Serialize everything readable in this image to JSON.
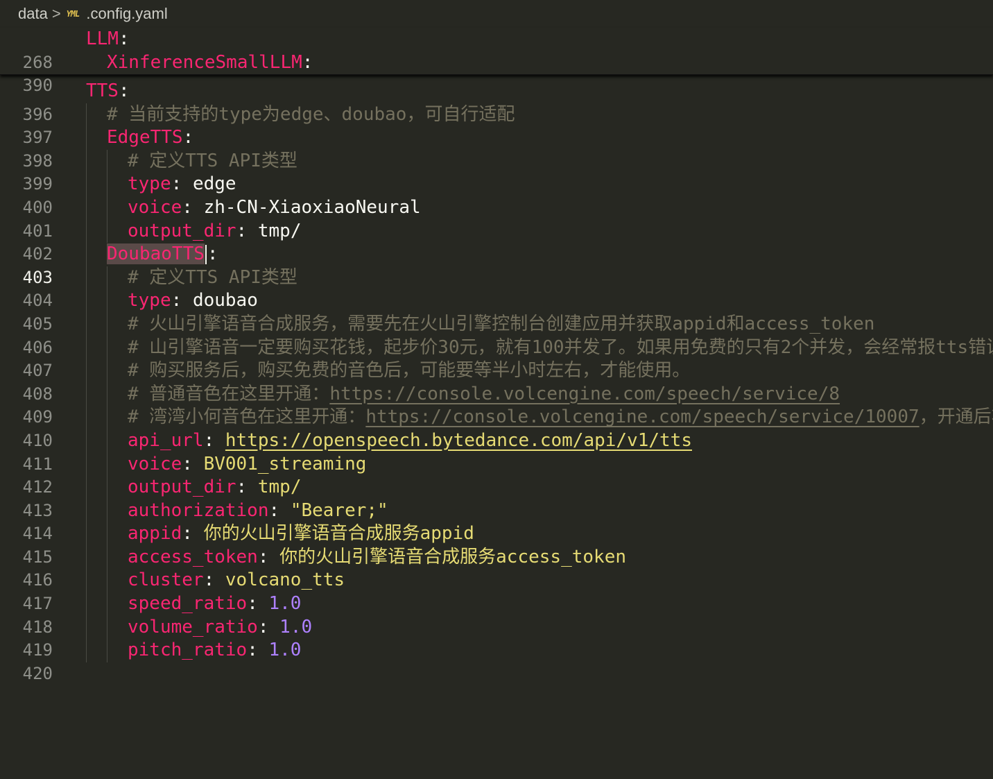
{
  "breadcrumb": {
    "folder": "data",
    "separator": ">",
    "file_icon": "YML",
    "file_name": ".config.yaml"
  },
  "sticky": [
    {
      "ln": "268",
      "key": "LLM",
      "colon": ":"
    },
    {
      "ln": "390",
      "key": "XinferenceSmallLLM",
      "colon": ":"
    }
  ],
  "lines": {
    "l396": {
      "ln": "396",
      "key": "TTS",
      "colon": ":"
    },
    "l397": {
      "ln": "397",
      "text": "# 当前支持的type为edge、doubao，可自行适配"
    },
    "l398": {
      "ln": "398",
      "key": "EdgeTTS",
      "colon": ":"
    },
    "l399": {
      "ln": "399",
      "text": "# 定义TTS API类型"
    },
    "l400": {
      "ln": "400",
      "key": "type",
      "colon": ": ",
      "value": "edge"
    },
    "l401": {
      "ln": "401",
      "key": "voice",
      "colon": ": ",
      "value": "zh-CN-XiaoxiaoNeural"
    },
    "l402": {
      "ln": "402",
      "key": "output_dir",
      "colon": ": ",
      "value": "tmp/"
    },
    "l403": {
      "ln": "403",
      "key": "DoubaoTTS",
      "colon": ":"
    },
    "l404": {
      "ln": "404",
      "text": "# 定义TTS API类型"
    },
    "l405": {
      "ln": "405",
      "key": "type",
      "colon": ": ",
      "value": "doubao"
    },
    "l406": {
      "ln": "406",
      "text": "# 火山引擎语音合成服务，需要先在火山引擎控制台创建应用并获取appid和access_token"
    },
    "l407": {
      "ln": "407",
      "text": "# 山引擎语音一定要购买花钱，起步价30元，就有100并发了。如果用免费的只有2个并发，会经常报tts错误"
    },
    "l408": {
      "ln": "408",
      "text": "# 购买服务后，购买免费的音色后，可能要等半小时左右，才能使用。"
    },
    "l409": {
      "ln": "409",
      "prefix": "# 普通音色在这里开通：",
      "link": "https://console.volcengine.com/speech/service/8"
    },
    "l410": {
      "ln": "410",
      "prefix": "# 湾湾小何音色在这里开通：",
      "link": "https://console.volcengine.com/speech/service/10007",
      "suffix": "，开通后将下"
    },
    "l411": {
      "ln": "411",
      "key": "api_url",
      "colon": ": ",
      "link": "https://openspeech.bytedance.com/api/v1/tts"
    },
    "l412": {
      "ln": "412",
      "key": "voice",
      "colon": ": ",
      "value": "BV001_streaming"
    },
    "l413": {
      "ln": "413",
      "key": "output_dir",
      "colon": ": ",
      "value": "tmp/"
    },
    "l414": {
      "ln": "414",
      "key": "authorization",
      "colon": ": ",
      "value": "\"Bearer;\""
    },
    "l415": {
      "ln": "415",
      "key": "appid",
      "colon": ": ",
      "value": "你的火山引擎语音合成服务appid"
    },
    "l416": {
      "ln": "416",
      "key": "access_token",
      "colon": ": ",
      "value": "你的火山引擎语音合成服务access_token"
    },
    "l417": {
      "ln": "417",
      "key": "cluster",
      "colon": ": ",
      "value": "volcano_tts"
    },
    "l418": {
      "ln": "418",
      "key": "speed_ratio",
      "colon": ": ",
      "value": "1.0"
    },
    "l419": {
      "ln": "419",
      "key": "volume_ratio",
      "colon": ": ",
      "value": "1.0"
    },
    "l420": {
      "ln": "420",
      "key": "pitch_ratio",
      "colon": ": ",
      "value": "1.0"
    }
  },
  "active_line": "403",
  "colors": {
    "background": "#272822",
    "key": "#f92672",
    "value": "#e6db74",
    "number": "#ae81ff",
    "comment": "#75715e"
  }
}
